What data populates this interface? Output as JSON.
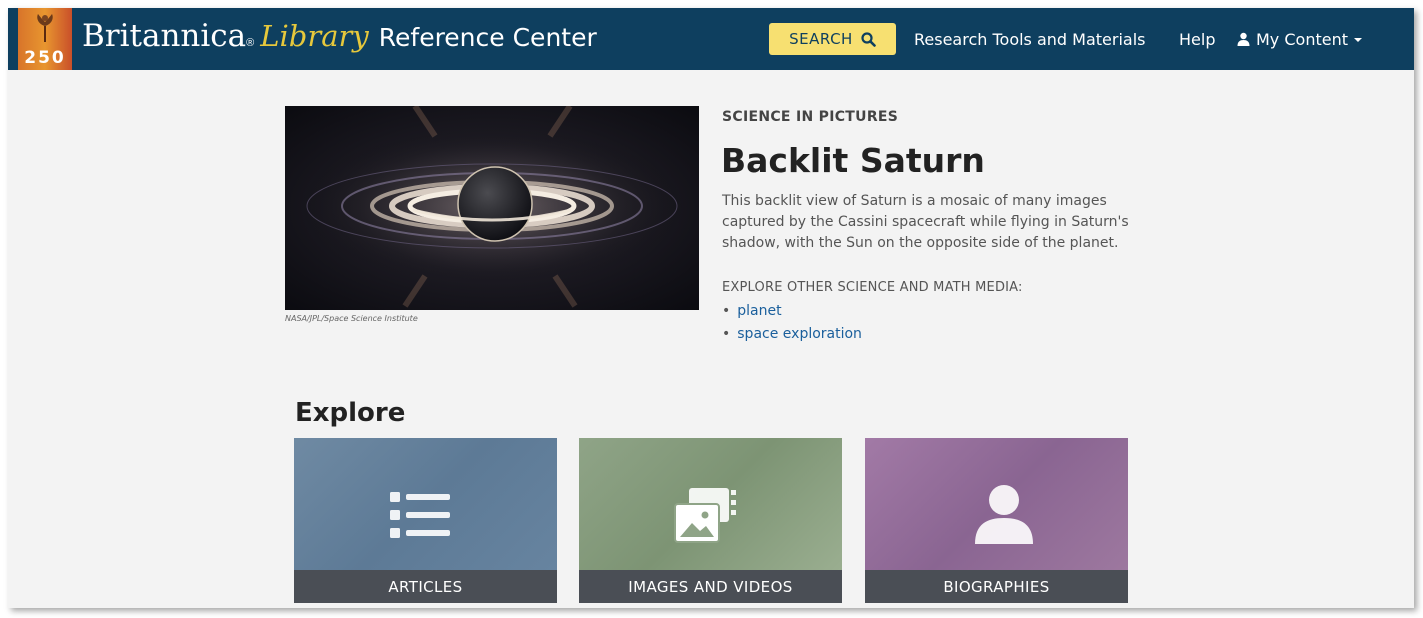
{
  "header": {
    "logo_number": "250",
    "brand_main": "Britannica",
    "brand_reg": "®",
    "brand_library": "Library",
    "brand_rest": "Reference Center",
    "search_label": "SEARCH",
    "nav_research": "Research Tools and Materials",
    "nav_help": "Help",
    "nav_mycontent": "My Content"
  },
  "feature": {
    "image_credit": "NASA/JPL/Space Science Institute",
    "kicker": "SCIENCE IN PICTURES",
    "title": "Backlit Saturn",
    "description": "This backlit view of Saturn is a mosaic of many images captured by the Cassini spacecraft while flying in Saturn's shadow, with the Sun on the opposite side of the planet.",
    "explore_other_label": "EXPLORE OTHER SCIENCE AND MATH MEDIA:",
    "links": [
      "planet",
      "space exploration"
    ]
  },
  "explore": {
    "heading": "Explore",
    "cards": [
      {
        "label": "ARTICLES",
        "icon": "list-icon"
      },
      {
        "label": "IMAGES AND VIDEOS",
        "icon": "media-icon"
      },
      {
        "label": "BIOGRAPHIES",
        "icon": "person-icon"
      }
    ]
  },
  "colors": {
    "header_bg": "#0e3f5f",
    "search_bg": "#f7e071",
    "library_gold": "#e6c83c",
    "link_blue": "#1a5f9c",
    "card_label_bg": "#4a4e55"
  }
}
